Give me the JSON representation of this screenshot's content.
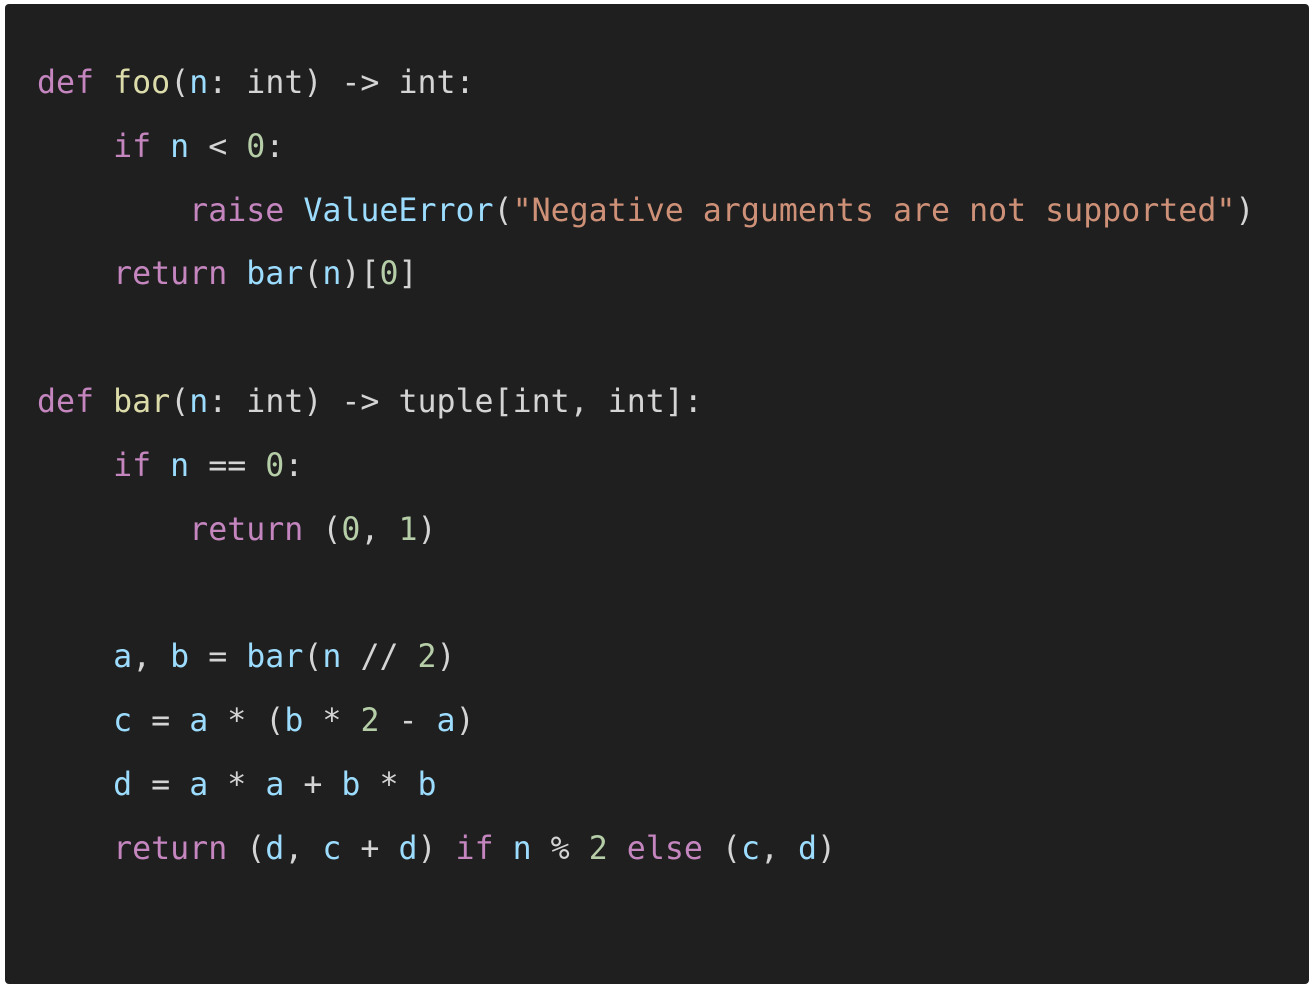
{
  "editor": {
    "colors": {
      "background": "#1f1f1f",
      "keyword": "#c586c0",
      "function": "#dcdcaa",
      "class": "#4ec9b0",
      "variable": "#9cdcfe",
      "number": "#b5cea8",
      "string": "#ce9178",
      "plain": "#d4d4d4"
    },
    "lines": [
      [
        [
          "kw",
          "def"
        ],
        [
          "pl",
          " "
        ],
        [
          "fn",
          "foo"
        ],
        [
          "pl",
          "("
        ],
        [
          "var",
          "n"
        ],
        [
          "pl",
          ": int) -> int:"
        ]
      ],
      [
        [
          "pl",
          "    "
        ],
        [
          "kw",
          "if"
        ],
        [
          "pl",
          " "
        ],
        [
          "var",
          "n"
        ],
        [
          "pl",
          " < "
        ],
        [
          "num",
          "0"
        ],
        [
          "pl",
          ":"
        ]
      ],
      [
        [
          "pl",
          "        "
        ],
        [
          "kw",
          "raise"
        ],
        [
          "pl",
          " "
        ],
        [
          "var",
          "ValueError"
        ],
        [
          "pl",
          "("
        ],
        [
          "str",
          "\"Negative arguments are not supported\""
        ],
        [
          "pl",
          ")"
        ]
      ],
      [
        [
          "pl",
          "    "
        ],
        [
          "kw",
          "return"
        ],
        [
          "pl",
          " "
        ],
        [
          "var",
          "bar"
        ],
        [
          "pl",
          "("
        ],
        [
          "var",
          "n"
        ],
        [
          "pl",
          ")["
        ],
        [
          "num",
          "0"
        ],
        [
          "pl",
          "]"
        ]
      ],
      [],
      [
        [
          "kw",
          "def"
        ],
        [
          "pl",
          " "
        ],
        [
          "fn",
          "bar"
        ],
        [
          "pl",
          "("
        ],
        [
          "var",
          "n"
        ],
        [
          "pl",
          ": int) -> tuple[int, int]:"
        ]
      ],
      [
        [
          "pl",
          "    "
        ],
        [
          "kw",
          "if"
        ],
        [
          "pl",
          " "
        ],
        [
          "var",
          "n"
        ],
        [
          "pl",
          " == "
        ],
        [
          "num",
          "0"
        ],
        [
          "pl",
          ":"
        ]
      ],
      [
        [
          "pl",
          "        "
        ],
        [
          "kw",
          "return"
        ],
        [
          "pl",
          " ("
        ],
        [
          "num",
          "0"
        ],
        [
          "pl",
          ", "
        ],
        [
          "num",
          "1"
        ],
        [
          "pl",
          ")"
        ]
      ],
      [],
      [
        [
          "pl",
          "    "
        ],
        [
          "var",
          "a"
        ],
        [
          "pl",
          ", "
        ],
        [
          "var",
          "b"
        ],
        [
          "pl",
          " = "
        ],
        [
          "var",
          "bar"
        ],
        [
          "pl",
          "("
        ],
        [
          "var",
          "n"
        ],
        [
          "pl",
          " // "
        ],
        [
          "num",
          "2"
        ],
        [
          "pl",
          ")"
        ]
      ],
      [
        [
          "pl",
          "    "
        ],
        [
          "var",
          "c"
        ],
        [
          "pl",
          " = "
        ],
        [
          "var",
          "a"
        ],
        [
          "pl",
          " * ("
        ],
        [
          "var",
          "b"
        ],
        [
          "pl",
          " * "
        ],
        [
          "num",
          "2"
        ],
        [
          "pl",
          " - "
        ],
        [
          "var",
          "a"
        ],
        [
          "pl",
          ")"
        ]
      ],
      [
        [
          "pl",
          "    "
        ],
        [
          "var",
          "d"
        ],
        [
          "pl",
          " = "
        ],
        [
          "var",
          "a"
        ],
        [
          "pl",
          " * "
        ],
        [
          "var",
          "a"
        ],
        [
          "pl",
          " + "
        ],
        [
          "var",
          "b"
        ],
        [
          "pl",
          " * "
        ],
        [
          "var",
          "b"
        ]
      ],
      [
        [
          "pl",
          "    "
        ],
        [
          "kw",
          "return"
        ],
        [
          "pl",
          " ("
        ],
        [
          "var",
          "d"
        ],
        [
          "pl",
          ", "
        ],
        [
          "var",
          "c"
        ],
        [
          "pl",
          " + "
        ],
        [
          "var",
          "d"
        ],
        [
          "pl",
          ") "
        ],
        [
          "kw",
          "if"
        ],
        [
          "pl",
          " "
        ],
        [
          "var",
          "n"
        ],
        [
          "pl",
          " % "
        ],
        [
          "num",
          "2"
        ],
        [
          "pl",
          " "
        ],
        [
          "kw",
          "else"
        ],
        [
          "pl",
          " ("
        ],
        [
          "var",
          "c"
        ],
        [
          "pl",
          ", "
        ],
        [
          "var",
          "d"
        ],
        [
          "pl",
          ")"
        ]
      ]
    ]
  }
}
